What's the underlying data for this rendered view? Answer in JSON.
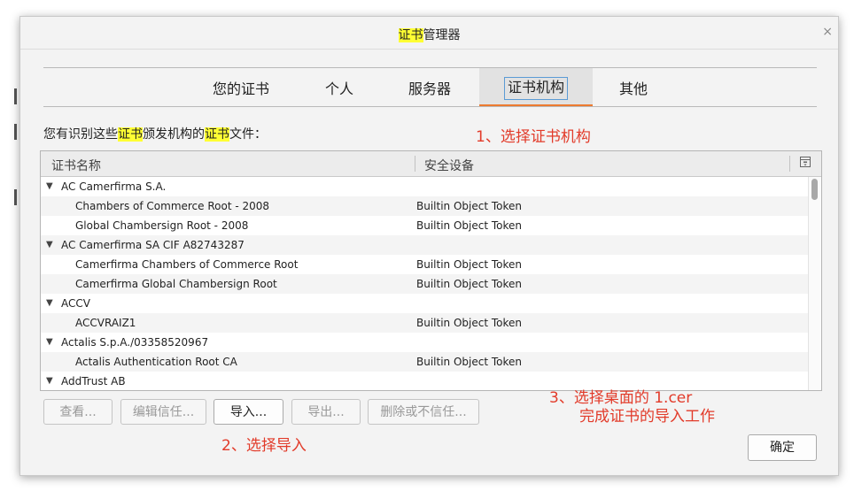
{
  "dialog": {
    "title_hl": "证书",
    "title_rest": "管理器",
    "close": "×"
  },
  "tabs": [
    "您的证书",
    "个人",
    "服务器",
    "证书机构",
    "其他"
  ],
  "active_tab_index": 3,
  "description": {
    "part1": "您有识别这些",
    "hl1": "证书",
    "part2": "颁发机构的",
    "hl2": "证书",
    "part3": "文件："
  },
  "columns": {
    "name": "证书名称",
    "device": "安全设备"
  },
  "rows": [
    {
      "type": "group",
      "name": "AC Camerfirma S.A.",
      "device": ""
    },
    {
      "type": "child",
      "name": "Chambers of Commerce Root - 2008",
      "device": "Builtin Object Token"
    },
    {
      "type": "child",
      "name": "Global Chambersign Root - 2008",
      "device": "Builtin Object Token"
    },
    {
      "type": "group",
      "name": "AC Camerfirma SA CIF A82743287",
      "device": ""
    },
    {
      "type": "child",
      "name": "Camerfirma Chambers of Commerce Root",
      "device": "Builtin Object Token"
    },
    {
      "type": "child",
      "name": "Camerfirma Global Chambersign Root",
      "device": "Builtin Object Token"
    },
    {
      "type": "group",
      "name": "ACCV",
      "device": ""
    },
    {
      "type": "child",
      "name": "ACCVRAIZ1",
      "device": "Builtin Object Token"
    },
    {
      "type": "group",
      "name": "Actalis S.p.A./03358520967",
      "device": ""
    },
    {
      "type": "child",
      "name": "Actalis Authentication Root CA",
      "device": "Builtin Object Token"
    },
    {
      "type": "group",
      "name": "AddTrust AB",
      "device": ""
    }
  ],
  "buttons": {
    "view": "查看...",
    "edit_trust": "编辑信任...",
    "import": "导入...",
    "export": "导出...",
    "delete": "删除或不信任...",
    "ok": "确定"
  },
  "annotations": {
    "step1": "1、选择证书机构",
    "step2": "2、选择导入",
    "step3_line1": "3、选择桌面的 1.cer",
    "step3_line2": "完成证书的导入工作"
  },
  "colors": {
    "annotation_red": "#e23b2a",
    "highlight_yellow": "#ffff33",
    "tab_accent_orange": "#ec7a30"
  }
}
